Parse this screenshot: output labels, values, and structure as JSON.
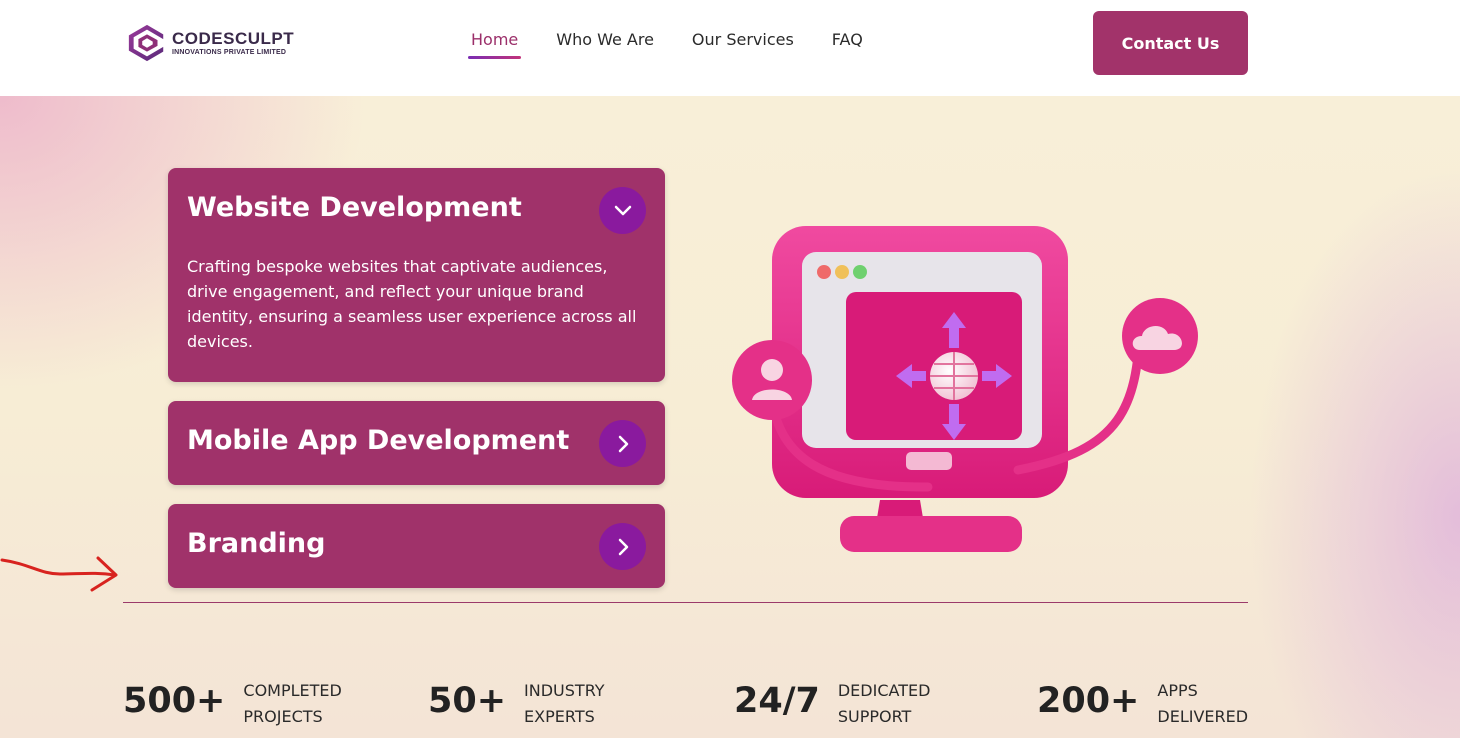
{
  "brand": {
    "name": "CODESCULPT",
    "subtitle": "INNOVATIONS PRIVATE LIMITED",
    "colors": {
      "primary": "#a0326a",
      "accent": "#8a1a9e"
    }
  },
  "nav": {
    "items": [
      {
        "label": "Home",
        "active": true
      },
      {
        "label": "Who We Are",
        "active": false
      },
      {
        "label": "Our Services",
        "active": false
      },
      {
        "label": "FAQ",
        "active": false
      }
    ],
    "cta": "Contact Us"
  },
  "services": [
    {
      "title": "Website Development",
      "expanded": true,
      "icon": "chevron-down-icon",
      "description": "Crafting bespoke websites that captivate audiences, drive engagement, and reflect your unique brand identity, ensuring a seamless user experience across all devices."
    },
    {
      "title": "Mobile App Development",
      "expanded": false,
      "icon": "chevron-right-icon"
    },
    {
      "title": "Branding",
      "expanded": false,
      "icon": "chevron-right-icon"
    }
  ],
  "stats": [
    {
      "value": "500+",
      "label_line1": "COMPLETED",
      "label_line2": "PROJECTS"
    },
    {
      "value": "50+",
      "label_line1": "INDUSTRY",
      "label_line2": "EXPERTS"
    },
    {
      "value": "24/7",
      "label_line1": "DEDICATED",
      "label_line2": "SUPPORT"
    },
    {
      "value": "200+",
      "label_line1": "APPS",
      "label_line2": "DELIVERED"
    }
  ],
  "illustration": {
    "icon": "monitor-globe-icon"
  },
  "annotation": {
    "icon": "red-arrow-icon",
    "color": "#d8231f"
  }
}
